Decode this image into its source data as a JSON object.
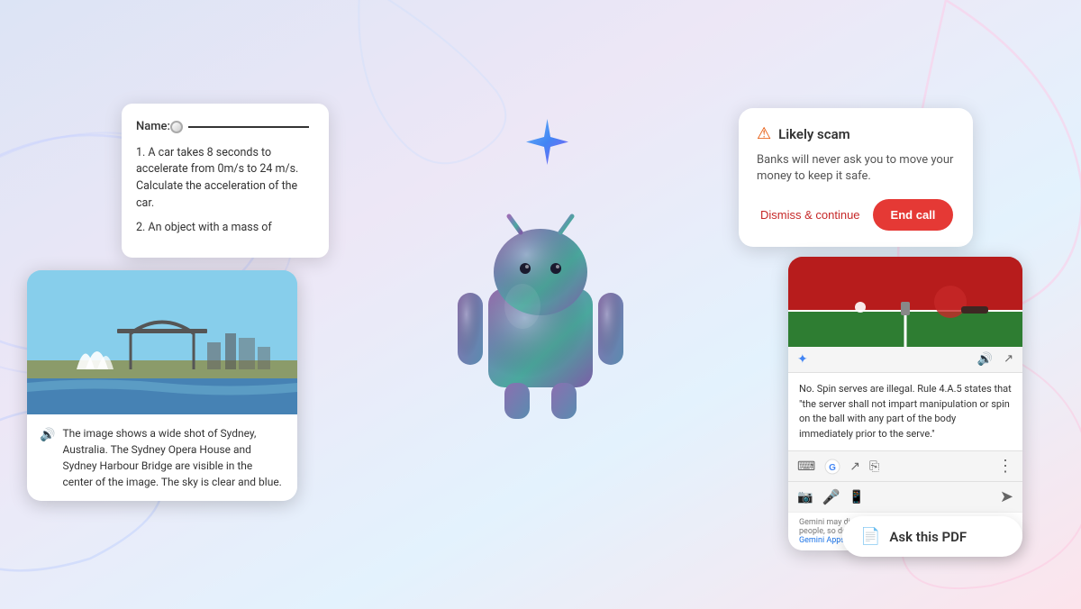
{
  "background": {
    "gradient_desc": "light purple to pink to blue gradient"
  },
  "gemini_star": {
    "symbol": "✦"
  },
  "worksheet_card": {
    "name_label": "Name:",
    "questions": [
      "1.  A car takes 8 seconds to accelerate from 0m/s to 24 m/s. Calculate the acceleration of the car.",
      "2.  An object with a mass of"
    ]
  },
  "scam_card": {
    "icon": "⚠",
    "title": "Likely scam",
    "body": "Banks will never ask you to move your money to keep it safe.",
    "dismiss_label": "Dismiss & continue",
    "end_call_label": "End call"
  },
  "sydney_card": {
    "caption": "The image shows a wide shot of Sydney, Australia. The Sydney Opera House and Sydney Harbour Bridge are visible in the center of the image. The sky is clear and blue.",
    "speaker_icon": "🔊"
  },
  "browser_card": {
    "gemini_star": "✦",
    "content": "No. Spin serves are illegal. Rule 4.A.5 states that \"the server shall not impart manipulation or spin on the ball with any part of the body immediately prior to the serve.\"",
    "footer": "Gemini may display inaccurate info, including about people, so double-check its responses.",
    "footer_link": "Your privacy & Gemini Apps"
  },
  "pdf_bar": {
    "icon": "📄",
    "label": "Ask this PDF"
  }
}
